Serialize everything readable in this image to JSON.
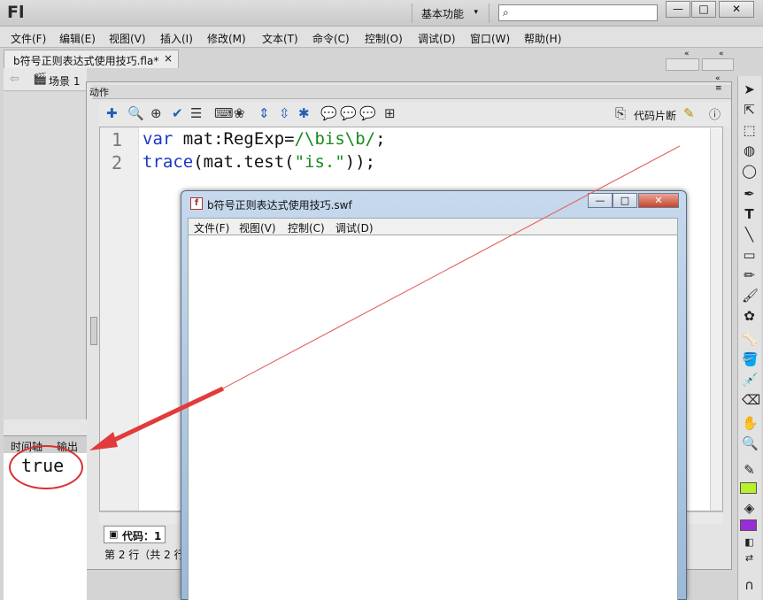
{
  "app": {
    "logo": "Fl",
    "workspace": "基本功能"
  },
  "window_buttons": {
    "minimize": "—",
    "maximize": "□",
    "close": "✕"
  },
  "menu": [
    "文件(F)",
    "编辑(E)",
    "视图(V)",
    "插入(I)",
    "修改(M)",
    "文本(T)",
    "命令(C)",
    "控制(O)",
    "调试(D)",
    "窗口(W)",
    "帮助(H)"
  ],
  "document": {
    "tab_title": "b符号正则表达式使用技巧.fla*",
    "close": "×",
    "scene": "场景 1"
  },
  "actions_panel": {
    "title": "动作",
    "snippet_label": "代码片断",
    "code_lines": [
      {
        "no": "1",
        "parts": [
          "var",
          " mat:RegExp=",
          "/\\bis\\b/",
          ";"
        ]
      },
      {
        "no": "2",
        "parts": [
          "trace",
          "(mat.test(",
          "\"is.\"",
          "));"
        ]
      }
    ],
    "code_tab": "代码：1",
    "status": "第 2 行（共 2 行"
  },
  "bottom_panel": {
    "tabs": [
      "时间轴",
      "输出"
    ],
    "output": "true"
  },
  "swf_window": {
    "title": "b符号正则表达式使用技巧.swf",
    "menu": [
      "文件(F)",
      "视图(V)",
      "控制(C)",
      "调试(D)"
    ],
    "buttons": {
      "minimize": "—",
      "maximize": "□",
      "close": "✕"
    }
  },
  "colors": {
    "annotation": "#d93030",
    "stroke": "#b8f02a",
    "fill": "#9a2cd8"
  }
}
